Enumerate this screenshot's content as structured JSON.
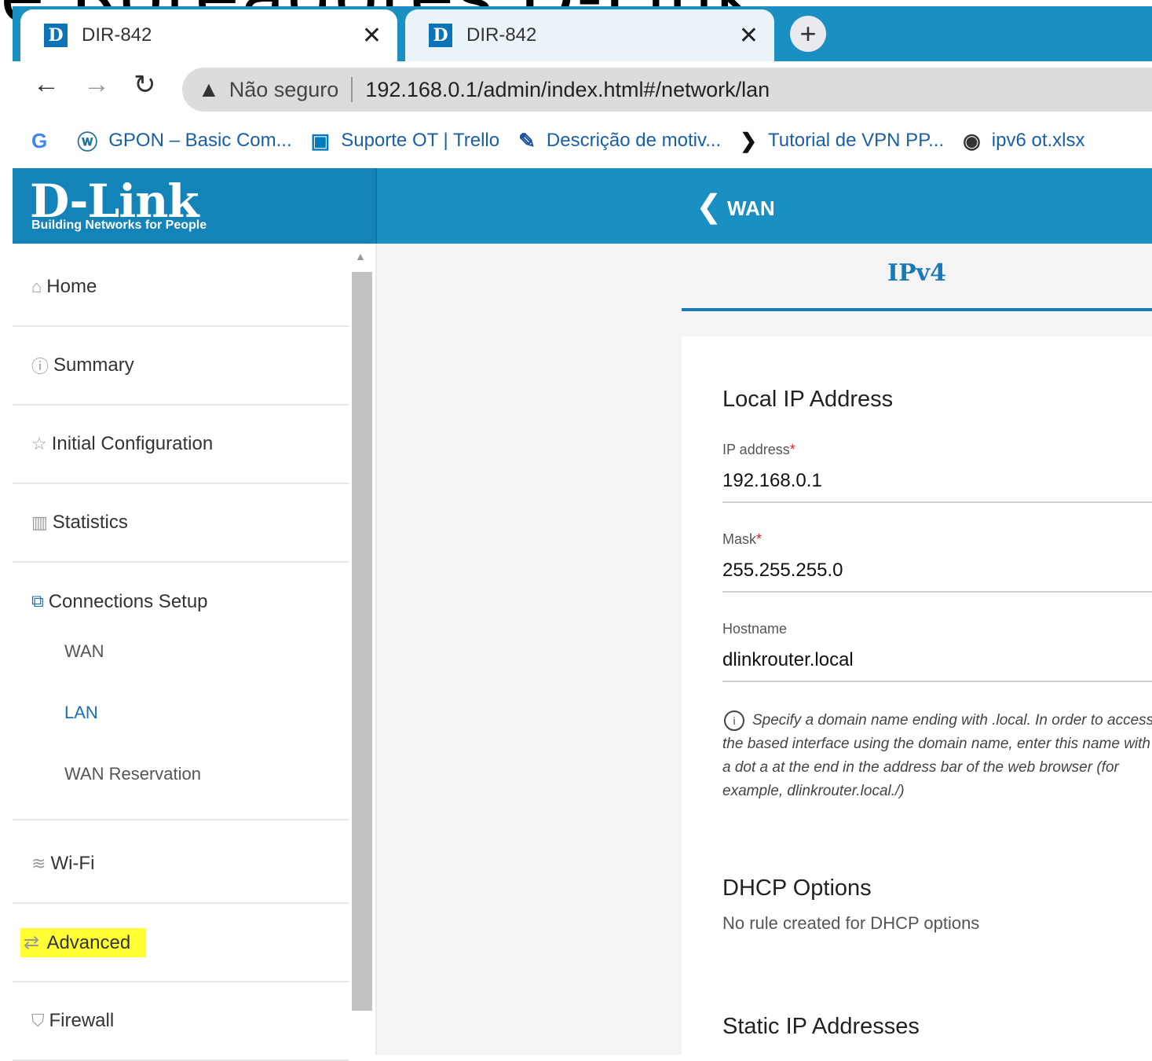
{
  "overlay": {
    "text": "e Roteadores D-Link"
  },
  "browser": {
    "tabs": [
      {
        "title": "DIR-842",
        "favicon": "D"
      },
      {
        "title": "DIR-842",
        "favicon": "D"
      }
    ],
    "new_tab": "+",
    "address": {
      "security": "Não seguro",
      "url": "192.168.0.1/admin/index.html#/network/lan"
    },
    "bookmarks": [
      {
        "icon": "G",
        "label": ""
      },
      {
        "icon": "ⓦ",
        "label": "GPON – Basic Com..."
      },
      {
        "icon": "▣",
        "label": "Suporte OT | Trello"
      },
      {
        "icon": "✎",
        "label": "Descrição de motiv..."
      },
      {
        "icon": "❯",
        "label": "Tutorial de VPN PP..."
      },
      {
        "icon": "◉",
        "label": "ipv6 ot.xlsx"
      }
    ]
  },
  "router": {
    "logo": "D-Link",
    "tagline": "Building Networks for People",
    "back_label": "WAN"
  },
  "sidebar": {
    "items": [
      {
        "label": "Home"
      },
      {
        "label": "Summary"
      },
      {
        "label": "Initial Configuration"
      },
      {
        "label": "Statistics"
      },
      {
        "label": "Connections Setup"
      },
      {
        "label": "Wi-Fi"
      },
      {
        "label": "Advanced"
      },
      {
        "label": "Firewall"
      }
    ],
    "sub_items": [
      {
        "label": "WAN"
      },
      {
        "label": "LAN"
      },
      {
        "label": "WAN Reservation"
      }
    ]
  },
  "main": {
    "tab": "IPv4",
    "local_ip": {
      "title": "Local IP Address",
      "ip_label": "IP address",
      "ip_value": "192.168.0.1",
      "mask_label": "Mask",
      "mask_value": "255.255.255.0",
      "hostname_label": "Hostname",
      "hostname_value": "dlinkrouter.local",
      "required_mark": "*",
      "hint": "Specify a domain name ending with .local. In order to access the based interface using the domain name, enter this name with a dot a at the end in the address bar of the web browser (for example, dlinkrouter.local./)"
    },
    "dhcp": {
      "title": "DHCP Options",
      "empty": "No rule created for DHCP options"
    },
    "static": {
      "title": "Static IP Addresses"
    }
  },
  "colors": {
    "brand": "#1a8fc1",
    "highlight": "#ffff33",
    "accent": "#1a7ab8"
  }
}
